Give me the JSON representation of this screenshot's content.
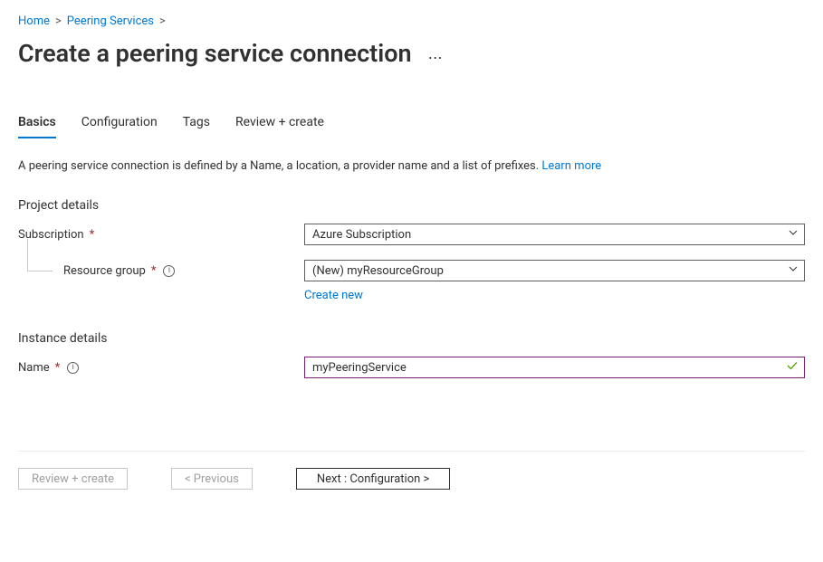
{
  "breadcrumb": {
    "home": "Home",
    "peering_services": "Peering Services"
  },
  "page_title": "Create a peering service connection",
  "tabs": {
    "basics": "Basics",
    "configuration": "Configuration",
    "tags": "Tags",
    "review_create": "Review + create"
  },
  "description": {
    "text": "A peering service connection is defined by a Name, a location, a provider name and a list of prefixes. ",
    "learn_more": "Learn more"
  },
  "sections": {
    "project_details": "Project details",
    "instance_details": "Instance details"
  },
  "fields": {
    "subscription": {
      "label": "Subscription",
      "value": "Azure Subscription"
    },
    "resource_group": {
      "label": "Resource group",
      "value": "(New) myResourceGroup",
      "create_new": "Create new"
    },
    "name": {
      "label": "Name",
      "value": "myPeeringService"
    }
  },
  "footer": {
    "review_create": "Review + create",
    "previous": "< Previous",
    "next": "Next : Configuration >"
  }
}
